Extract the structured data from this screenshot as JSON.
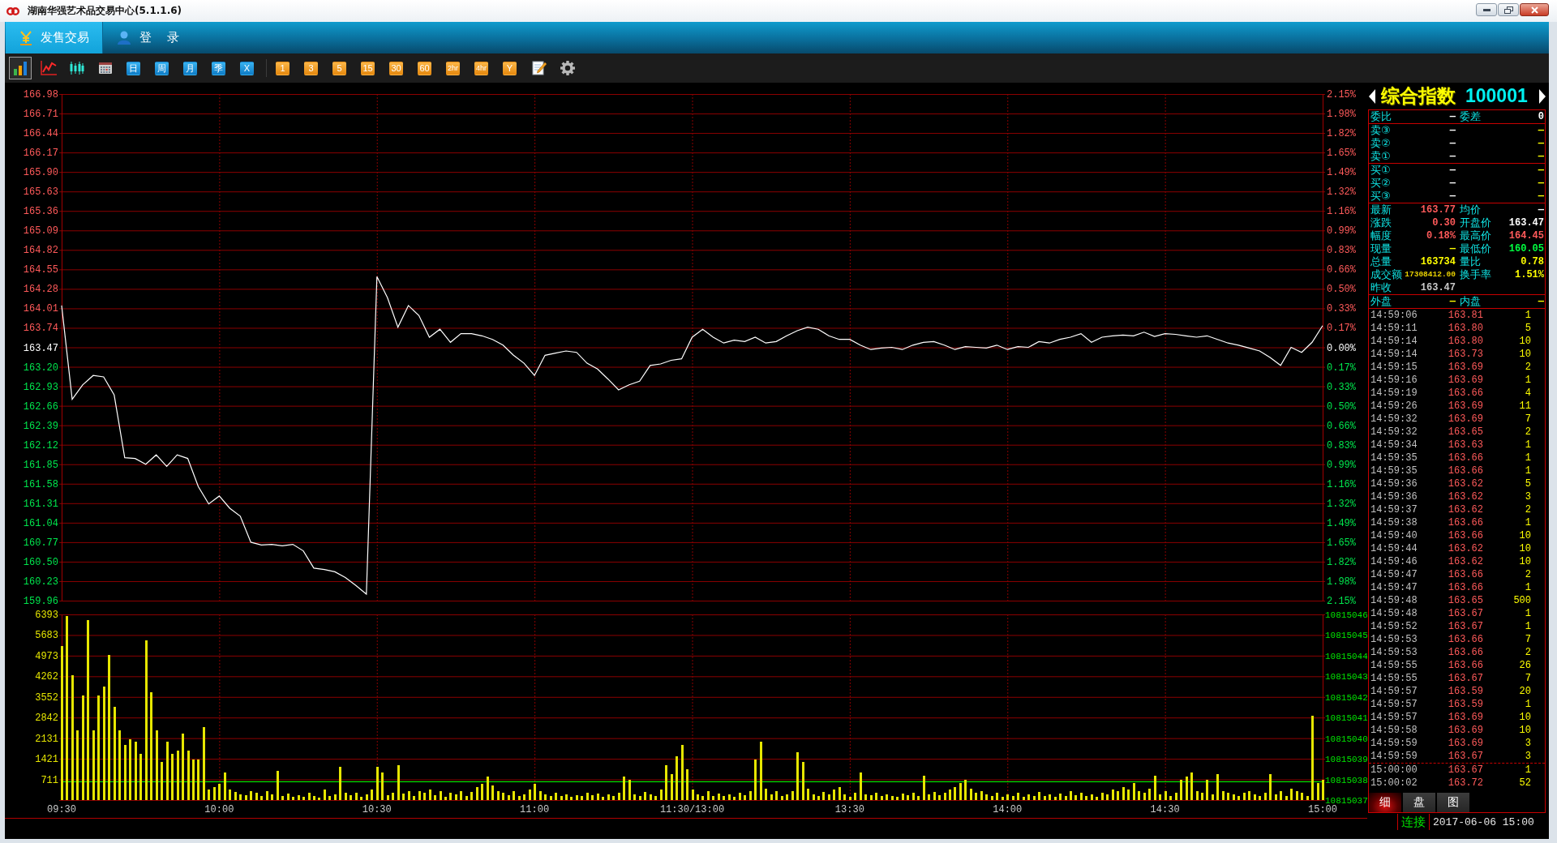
{
  "window": {
    "title": "湖南华强艺术品交易中心(5.1.1.6)"
  },
  "nav": {
    "tabs": [
      {
        "label": "发售交易",
        "kind": "sale",
        "selected": true
      },
      {
        "label": "登 录",
        "kind": "login",
        "selected": false
      }
    ]
  },
  "toolbar": {
    "views": [
      {
        "kind": "bars",
        "selected": true
      },
      {
        "kind": "line",
        "selected": false
      },
      {
        "kind": "candles",
        "selected": false
      },
      {
        "kind": "calendar",
        "selected": false
      }
    ],
    "periods": [
      {
        "label": "日",
        "selected": false
      },
      {
        "label": "周",
        "selected": false
      },
      {
        "label": "月",
        "selected": false
      },
      {
        "label": "季",
        "selected": false
      },
      {
        "label": "X",
        "selected": false
      }
    ],
    "intervals": [
      {
        "label": "1",
        "selected": false
      },
      {
        "label": "3",
        "selected": false
      },
      {
        "label": "5",
        "selected": false
      },
      {
        "label": "15",
        "selected": false
      },
      {
        "label": "30",
        "selected": false
      },
      {
        "label": "60",
        "selected": false
      },
      {
        "label": "2hr",
        "selected": false
      },
      {
        "label": "4hr",
        "selected": false
      },
      {
        "label": "Y",
        "selected": false
      }
    ],
    "tools": [
      {
        "kind": "notes"
      },
      {
        "kind": "settings"
      }
    ]
  },
  "price_chart": {
    "chart_data": {
      "type": "line",
      "grid": true,
      "ylim": [
        159.96,
        166.98
      ],
      "yticks": [
        {
          "value": 166.98,
          "label": "166.98"
        },
        {
          "value": 166.71,
          "label": "166.71"
        },
        {
          "value": 166.44,
          "label": "166.44"
        },
        {
          "value": 166.17,
          "label": "166.17"
        },
        {
          "value": 165.9,
          "label": "165.90"
        },
        {
          "value": 165.63,
          "label": "165.63"
        },
        {
          "value": 165.36,
          "label": "165.36"
        },
        {
          "value": 165.09,
          "label": "165.09"
        },
        {
          "value": 164.82,
          "label": "164.82"
        },
        {
          "value": 164.55,
          "label": "164.55"
        },
        {
          "value": 164.28,
          "label": "164.28"
        },
        {
          "value": 164.01,
          "label": "164.01"
        },
        {
          "value": 163.74,
          "label": "163.74"
        },
        {
          "value": 163.47,
          "label": "163.47"
        },
        {
          "value": 163.2,
          "label": "163.20"
        },
        {
          "value": 162.93,
          "label": "162.93"
        },
        {
          "value": 162.66,
          "label": "162.66"
        },
        {
          "value": 162.39,
          "label": "162.39"
        },
        {
          "value": 162.12,
          "label": "162.12"
        },
        {
          "value": 161.85,
          "label": "161.85"
        },
        {
          "value": 161.58,
          "label": "161.58"
        },
        {
          "value": 161.31,
          "label": "161.31"
        },
        {
          "value": 161.04,
          "label": "161.04"
        },
        {
          "value": 160.77,
          "label": "160.77"
        },
        {
          "value": 160.5,
          "label": "160.50"
        },
        {
          "value": 160.23,
          "label": "160.23"
        },
        {
          "value": 159.96,
          "label": "159.96"
        }
      ],
      "categories": [
        null,
        null,
        null,
        null,
        null,
        null,
        null,
        null,
        null,
        null,
        null,
        null,
        null,
        null,
        null,
        null,
        null,
        null,
        null,
        null,
        null,
        null,
        null,
        null,
        null,
        null,
        null,
        null,
        null,
        null,
        null,
        null,
        null,
        null,
        null,
        null,
        null,
        null,
        null,
        null,
        null,
        null,
        null,
        null,
        null,
        null,
        null,
        null,
        null,
        null,
        null,
        null,
        null,
        null,
        null,
        null,
        null,
        null,
        null,
        null,
        null,
        null,
        null,
        null,
        null,
        null,
        null,
        null,
        null,
        null,
        null,
        null,
        null,
        null,
        null,
        null,
        null,
        null,
        null,
        null,
        null,
        null,
        null,
        null,
        null,
        null,
        null,
        null,
        null,
        null,
        null,
        null,
        null,
        null,
        null,
        null,
        null,
        null,
        null,
        null,
        null,
        null,
        null,
        null,
        null,
        null,
        null,
        null,
        null,
        null,
        null,
        null,
        null,
        null,
        null,
        null,
        null,
        null,
        null,
        null,
        null
      ],
      "values": [
        164.05,
        162.75,
        162.95,
        163.08,
        163.06,
        162.81,
        161.94,
        161.93,
        161.85,
        161.98,
        161.82,
        161.98,
        161.93,
        161.54,
        161.3,
        161.41,
        161.24,
        161.13,
        160.77,
        160.73,
        160.74,
        160.72,
        160.74,
        160.65,
        160.41,
        160.39,
        160.36,
        160.28,
        160.17,
        160.05,
        164.45,
        164.16,
        163.75,
        164.05,
        163.91,
        163.61,
        163.72,
        163.54,
        163.66,
        163.66,
        163.63,
        163.58,
        163.5,
        163.36,
        163.25,
        163.08,
        163.36,
        163.39,
        163.42,
        163.4,
        163.25,
        163.17,
        163.03,
        162.88,
        162.95,
        163.0,
        163.22,
        163.24,
        163.29,
        163.31,
        163.61,
        163.72,
        163.61,
        163.53,
        163.57,
        163.55,
        163.61,
        163.53,
        163.55,
        163.63,
        163.7,
        163.75,
        163.72,
        163.63,
        163.58,
        163.58,
        163.5,
        163.44,
        163.46,
        163.47,
        163.44,
        163.5,
        163.54,
        163.55,
        163.5,
        163.44,
        163.48,
        163.47,
        163.46,
        163.5,
        163.44,
        163.48,
        163.47,
        163.55,
        163.53,
        163.58,
        163.61,
        163.66,
        163.54,
        163.61,
        163.63,
        163.64,
        163.63,
        163.68,
        163.62,
        163.66,
        163.65,
        163.63,
        163.61,
        163.63,
        163.58,
        163.53,
        163.5,
        163.46,
        163.42,
        163.33,
        163.22,
        163.47,
        163.4,
        163.54,
        163.77
      ]
    },
    "right_axis": [
      {
        "text": "2.15%",
        "color": "#ff5a5a"
      },
      {
        "text": "1.98%",
        "color": "#ff5a5a"
      },
      {
        "text": "1.82%",
        "color": "#ff5a5a"
      },
      {
        "text": "1.65%",
        "color": "#ff5a5a"
      },
      {
        "text": "1.49%",
        "color": "#ff5a5a"
      },
      {
        "text": "1.32%",
        "color": "#ff5a5a"
      },
      {
        "text": "1.16%",
        "color": "#ff5a5a"
      },
      {
        "text": "0.99%",
        "color": "#ff5a5a"
      },
      {
        "text": "0.83%",
        "color": "#ff5a5a"
      },
      {
        "text": "0.66%",
        "color": "#ff5a5a"
      },
      {
        "text": "0.50%",
        "color": "#ff5a5a"
      },
      {
        "text": "0.33%",
        "color": "#ff5a5a"
      },
      {
        "text": "0.17%",
        "color": "#ff5a5a"
      },
      {
        "text": "0.00%",
        "color": "#ffffff"
      },
      {
        "text": "0.17%",
        "color": "#00e64d"
      },
      {
        "text": "0.33%",
        "color": "#00e64d"
      },
      {
        "text": "0.50%",
        "color": "#00e64d"
      },
      {
        "text": "0.66%",
        "color": "#00e64d"
      },
      {
        "text": "0.83%",
        "color": "#00e64d"
      },
      {
        "text": "0.99%",
        "color": "#00e64d"
      },
      {
        "text": "1.16%",
        "color": "#00e64d"
      },
      {
        "text": "1.32%",
        "color": "#00e64d"
      },
      {
        "text": "1.49%",
        "color": "#00e64d"
      },
      {
        "text": "1.65%",
        "color": "#00e64d"
      },
      {
        "text": "1.82%",
        "color": "#00e64d"
      },
      {
        "text": "1.98%",
        "color": "#00e64d"
      },
      {
        "text": "2.15%",
        "color": "#00e64d"
      }
    ]
  },
  "volume_chart": {
    "chart_data": {
      "type": "bar",
      "grid": true,
      "ylim": [
        0,
        6393
      ],
      "yticks": [
        {
          "value": 6393,
          "label": "6393"
        },
        {
          "value": 5683,
          "label": "5683"
        },
        {
          "value": 4973,
          "label": "4973"
        },
        {
          "value": 4262,
          "label": "4262"
        },
        {
          "value": 3552,
          "label": "3552"
        },
        {
          "value": 2842,
          "label": "2842"
        },
        {
          "value": 2131,
          "label": "2131"
        },
        {
          "value": 1421,
          "label": "1421"
        },
        {
          "value": 711,
          "label": "711"
        }
      ],
      "categories": [
        "09:30",
        null,
        null,
        null,
        null,
        null,
        null,
        null,
        null,
        null,
        null,
        null,
        null,
        null,
        null,
        null,
        null,
        null,
        null,
        null,
        null,
        null,
        null,
        null,
        null,
        null,
        null,
        null,
        null,
        null,
        "10:00",
        null,
        null,
        null,
        null,
        null,
        null,
        null,
        null,
        null,
        null,
        null,
        null,
        null,
        null,
        null,
        null,
        null,
        null,
        null,
        null,
        null,
        null,
        null,
        null,
        null,
        null,
        null,
        null,
        null,
        "10:30",
        null,
        null,
        null,
        null,
        null,
        null,
        null,
        null,
        null,
        null,
        null,
        null,
        null,
        null,
        null,
        null,
        null,
        null,
        null,
        null,
        null,
        null,
        null,
        null,
        null,
        null,
        null,
        null,
        null,
        "11:00",
        null,
        null,
        null,
        null,
        null,
        null,
        null,
        null,
        null,
        null,
        null,
        null,
        null,
        null,
        null,
        null,
        null,
        null,
        null,
        null,
        null,
        null,
        null,
        null,
        null,
        null,
        null,
        null,
        null,
        "11:30/13:00",
        null,
        null,
        null,
        null,
        null,
        null,
        null,
        null,
        null,
        null,
        null,
        null,
        null,
        null,
        null,
        null,
        null,
        null,
        null,
        null,
        null,
        null,
        null,
        null,
        null,
        null,
        null,
        null,
        null,
        "13:30",
        null,
        null,
        null,
        null,
        null,
        null,
        null,
        null,
        null,
        null,
        null,
        null,
        null,
        null,
        null,
        null,
        null,
        null,
        null,
        null,
        null,
        null,
        null,
        null,
        null,
        null,
        null,
        null,
        null,
        "14:00",
        null,
        null,
        null,
        null,
        null,
        null,
        null,
        null,
        null,
        null,
        null,
        null,
        null,
        null,
        null,
        null,
        null,
        null,
        null,
        null,
        null,
        null,
        null,
        null,
        null,
        null,
        null,
        null,
        null,
        "14:30",
        null,
        null,
        null,
        null,
        null,
        null,
        null,
        null,
        null,
        null,
        null,
        null,
        null,
        null,
        null,
        null,
        null,
        null,
        null,
        null,
        null,
        null,
        null,
        null,
        null,
        null,
        null,
        null,
        null,
        "15:00"
      ],
      "values": [
        5300,
        6350,
        4300,
        2400,
        3600,
        6200,
        2400,
        3600,
        3900,
        5000,
        3200,
        2400,
        1900,
        2100,
        2000,
        1600,
        5500,
        3700,
        2400,
        1300,
        2000,
        1600,
        1700,
        2300,
        1700,
        1400,
        1400,
        2500,
        350,
        450,
        550,
        950,
        350,
        280,
        200,
        180,
        300,
        250,
        150,
        300,
        200,
        1000,
        150,
        220,
        100,
        180,
        120,
        260,
        150,
        90,
        350,
        130,
        200,
        1150,
        250,
        160,
        240,
        120,
        200,
        350,
        1150,
        950,
        180,
        260,
        1200,
        220,
        300,
        140,
        300,
        250,
        350,
        180,
        300,
        120,
        250,
        200,
        300,
        130,
        280,
        450,
        550,
        800,
        500,
        300,
        250,
        180,
        300,
        150,
        200,
        350,
        550,
        300,
        200,
        130,
        250,
        150,
        200,
        100,
        180,
        130,
        250,
        160,
        220,
        100,
        200,
        140,
        260,
        800,
        700,
        200,
        130,
        280,
        200,
        150,
        350,
        1200,
        900,
        1500,
        1900,
        1050,
        350,
        200,
        150,
        300,
        150,
        220,
        130,
        200,
        100,
        260,
        180,
        300,
        1400,
        2000,
        400,
        200,
        300,
        150,
        200,
        300,
        1650,
        1300,
        400,
        200,
        150,
        280,
        200,
        350,
        450,
        200,
        100,
        250,
        950,
        200,
        180,
        250,
        150,
        200,
        130,
        100,
        220,
        180,
        250,
        150,
        850,
        200,
        280,
        180,
        250,
        350,
        450,
        600,
        700,
        400,
        250,
        300,
        200,
        150,
        250,
        120,
        200,
        150,
        250,
        100,
        200,
        150,
        280,
        130,
        200,
        100,
        220,
        150,
        300,
        180,
        250,
        130,
        200,
        120,
        250,
        200,
        350,
        300,
        450,
        350,
        600,
        300,
        250,
        400,
        850,
        200,
        300,
        150,
        250,
        700,
        800,
        950,
        300,
        250,
        700,
        200,
        900,
        300,
        250,
        200,
        150,
        250,
        300,
        200,
        150,
        250,
        900,
        200,
        300,
        150,
        400,
        300,
        250,
        150,
        2900,
        600,
        700
      ],
      "ref_lines": [
        {
          "axis": "y",
          "value": 640
        }
      ]
    },
    "right_axis": [
      "10815046",
      "10815045",
      "10815044",
      "10815043",
      "10815042",
      "10815041",
      "10815040",
      "10815039",
      "10815038",
      "10815037"
    ]
  },
  "quote": {
    "name": "综合指数",
    "code": "100001",
    "ratio": {
      "left": {
        "label": "委比",
        "value": "—",
        "color": "#ffffff"
      },
      "right": {
        "label": "委差",
        "value": "0",
        "color": "#ffffff"
      }
    },
    "asks": [
      {
        "label": "卖③",
        "price": "—",
        "volume": "—"
      },
      {
        "label": "卖②",
        "price": "—",
        "volume": "—"
      },
      {
        "label": "卖①",
        "price": "—",
        "volume": "—"
      }
    ],
    "bids": [
      {
        "label": "买①",
        "price": "—",
        "volume": "—"
      },
      {
        "label": "买②",
        "price": "—",
        "volume": "—"
      },
      {
        "label": "买③",
        "price": "—",
        "volume": "—"
      }
    ],
    "stats": [
      {
        "left": {
          "label": "最新",
          "value": "163.77",
          "color": "#ff5a5a"
        },
        "right": {
          "label": "均价",
          "value": "—",
          "color": "#ffffff"
        }
      },
      {
        "left": {
          "label": "涨跌",
          "value": "0.30",
          "color": "#ff5a5a"
        },
        "right": {
          "label": "开盘价",
          "value": "163.47",
          "color": "#ffffff"
        }
      },
      {
        "left": {
          "label": "幅度",
          "value": "0.18%",
          "color": "#ff5a5a"
        },
        "right": {
          "label": "最高价",
          "value": "164.45",
          "color": "#ff5a5a"
        }
      },
      {
        "left": {
          "label": "现量",
          "value": "—",
          "color": "#ffff00"
        },
        "right": {
          "label": "最低价",
          "value": "160.05",
          "color": "#00ff40"
        }
      },
      {
        "left": {
          "label": "总量",
          "value": "163734",
          "color": "#ffff00"
        },
        "right": {
          "label": "量比",
          "value": "0.78",
          "color": "#ffff00"
        }
      },
      {
        "left": {
          "label": "成交额",
          "value": "17308412.00",
          "color": "#e8d000"
        },
        "right": {
          "label": "换手率",
          "value": "1.51%",
          "color": "#ffff00"
        }
      },
      {
        "left": {
          "label": "昨收",
          "value": "163.47",
          "color": "#c8c8c8"
        }
      }
    ],
    "flow": {
      "left": {
        "label": "外盘",
        "value": "—",
        "color": "#ffff00"
      },
      "right": {
        "label": "内盘",
        "value": "—",
        "color": "#ffff00"
      }
    },
    "trades": [
      {
        "time": "14:59:06",
        "price": "163.81",
        "volume": "1"
      },
      {
        "time": "14:59:11",
        "price": "163.80",
        "volume": "5"
      },
      {
        "time": "14:59:14",
        "price": "163.80",
        "volume": "10"
      },
      {
        "time": "14:59:14",
        "price": "163.73",
        "volume": "10"
      },
      {
        "time": "14:59:15",
        "price": "163.69",
        "volume": "2"
      },
      {
        "time": "14:59:16",
        "price": "163.69",
        "volume": "1"
      },
      {
        "time": "14:59:19",
        "price": "163.66",
        "volume": "4"
      },
      {
        "time": "14:59:26",
        "price": "163.69",
        "volume": "11"
      },
      {
        "time": "14:59:32",
        "price": "163.69",
        "volume": "7"
      },
      {
        "time": "14:59:32",
        "price": "163.65",
        "volume": "2"
      },
      {
        "time": "14:59:34",
        "price": "163.63",
        "volume": "1"
      },
      {
        "time": "14:59:35",
        "price": "163.66",
        "volume": "1"
      },
      {
        "time": "14:59:35",
        "price": "163.66",
        "volume": "1"
      },
      {
        "time": "14:59:36",
        "price": "163.62",
        "volume": "5"
      },
      {
        "time": "14:59:36",
        "price": "163.62",
        "volume": "3"
      },
      {
        "time": "14:59:37",
        "price": "163.62",
        "volume": "2"
      },
      {
        "time": "14:59:38",
        "price": "163.66",
        "volume": "1"
      },
      {
        "time": "14:59:40",
        "price": "163.66",
        "volume": "10"
      },
      {
        "time": "14:59:44",
        "price": "163.62",
        "volume": "10"
      },
      {
        "time": "14:59:46",
        "price": "163.62",
        "volume": "10"
      },
      {
        "time": "14:59:47",
        "price": "163.66",
        "volume": "2"
      },
      {
        "time": "14:59:47",
        "price": "163.66",
        "volume": "1"
      },
      {
        "time": "14:59:48",
        "price": "163.65",
        "volume": "500"
      },
      {
        "time": "14:59:48",
        "price": "163.67",
        "volume": "1"
      },
      {
        "time": "14:59:52",
        "price": "163.67",
        "volume": "1"
      },
      {
        "time": "14:59:53",
        "price": "163.66",
        "volume": "7"
      },
      {
        "time": "14:59:53",
        "price": "163.66",
        "volume": "2"
      },
      {
        "time": "14:59:55",
        "price": "163.66",
        "volume": "26"
      },
      {
        "time": "14:59:55",
        "price": "163.67",
        "volume": "7"
      },
      {
        "time": "14:59:57",
        "price": "163.59",
        "volume": "20"
      },
      {
        "time": "14:59:57",
        "price": "163.59",
        "volume": "1"
      },
      {
        "time": "14:59:57",
        "price": "163.69",
        "volume": "10"
      },
      {
        "time": "14:59:58",
        "price": "163.69",
        "volume": "10"
      },
      {
        "time": "14:59:59",
        "price": "163.69",
        "volume": "3"
      },
      {
        "time": "14:59:59",
        "price": "163.67",
        "volume": "3"
      }
    ],
    "closing_trades": [
      {
        "time": "15:00:00",
        "price": "163.67",
        "volume": "1"
      },
      {
        "time": "15:00:02",
        "price": "163.72",
        "volume": "52"
      }
    ],
    "tabs": [
      {
        "label": "细",
        "selected": true
      },
      {
        "label": "盘",
        "selected": false
      },
      {
        "label": "图",
        "selected": false
      }
    ]
  },
  "status_bar": {
    "connection": "连接",
    "datetime": "2017-06-06 15:00"
  }
}
